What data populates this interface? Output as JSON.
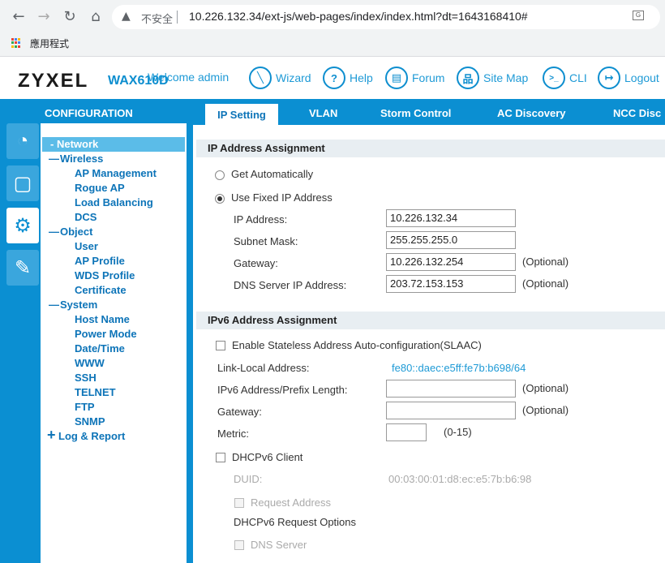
{
  "browser": {
    "back": "←",
    "forward": "→",
    "reload": "↻",
    "home": "⌂",
    "security_icon": "▲",
    "security_text": "不安全",
    "url": "10.226.132.34/ext-js/web-pages/index/index.html?dt=1643168410#",
    "bookmark_apps": "應用程式"
  },
  "header": {
    "brand": "ZYXEL",
    "model": "WAX610D",
    "welcome": "Welcome admin",
    "items": [
      {
        "label": "Wizard",
        "icon": "wand-icon",
        "glyph": "╲"
      },
      {
        "label": "Help",
        "icon": "help-icon",
        "glyph": "?"
      },
      {
        "label": "Forum",
        "icon": "forum-icon",
        "glyph": "▤"
      },
      {
        "label": "Site Map",
        "icon": "sitemap-icon",
        "glyph": "品"
      },
      {
        "label": "CLI",
        "icon": "cli-icon",
        "glyph": ">_"
      },
      {
        "label": "Logout",
        "icon": "logout-icon",
        "glyph": "↦"
      }
    ]
  },
  "sidebar": {
    "title": "CONFIGURATION",
    "icons": [
      "dashboard-icon",
      "monitor-icon",
      "gear-icon",
      "tools-icon"
    ],
    "menu": {
      "network": "Network",
      "network_prefix": "-",
      "wireless": "Wireless",
      "ap_management": "AP Management",
      "rogue_ap": "Rogue AP",
      "load_balancing": "Load Balancing",
      "dcs": "DCS",
      "object": "Object",
      "user": "User",
      "ap_profile": "AP Profile",
      "wds_profile": "WDS Profile",
      "certificate": "Certificate",
      "system": "System",
      "host_name": "Host Name",
      "power_mode": "Power Mode",
      "date_time": "Date/Time",
      "www": "WWW",
      "ssh": "SSH",
      "telnet": "TELNET",
      "ftp": "FTP",
      "snmp": "SNMP",
      "log_report": "Log & Report",
      "minus": "—",
      "plus": "+"
    }
  },
  "tabs": [
    "IP Setting",
    "VLAN",
    "Storm Control",
    "AC Discovery",
    "NCC Disc"
  ],
  "ipv4": {
    "section": "IP Address Assignment",
    "get_auto": "Get Automatically",
    "use_fixed": "Use Fixed IP Address",
    "ip_label": "IP Address:",
    "ip_value": "10.226.132.34",
    "mask_label": "Subnet Mask:",
    "mask_value": "255.255.255.0",
    "gw_label": "Gateway:",
    "gw_value": "10.226.132.254",
    "dns_label": "DNS Server IP Address:",
    "dns_value": "203.72.153.153",
    "optional": "(Optional)"
  },
  "ipv6": {
    "section": "IPv6 Address Assignment",
    "slaac": "Enable Stateless Address Auto-configuration(SLAAC)",
    "link_local_label": "Link-Local Address:",
    "link_local_value": "fe80::daec:e5ff:fe7b:b698/64",
    "prefix_label": "IPv6 Address/Prefix Length:",
    "gw_label": "Gateway:",
    "metric_label": "Metric:",
    "metric_range": "(0-15)",
    "optional": "(Optional)",
    "dhcp_client": "DHCPv6 Client",
    "duid_label": "DUID:",
    "duid_value": "00:03:00:01:d8:ec:e5:7b:b6:98",
    "request_address": "Request Address",
    "request_options": "DHCPv6 Request Options",
    "dns_server": "DNS Server"
  },
  "colors": {
    "brand_blue": "#0b8fd2",
    "link_blue": "#1e9ad6",
    "menu_blue": "#0d74b8",
    "active_item": "#5bbce8"
  }
}
